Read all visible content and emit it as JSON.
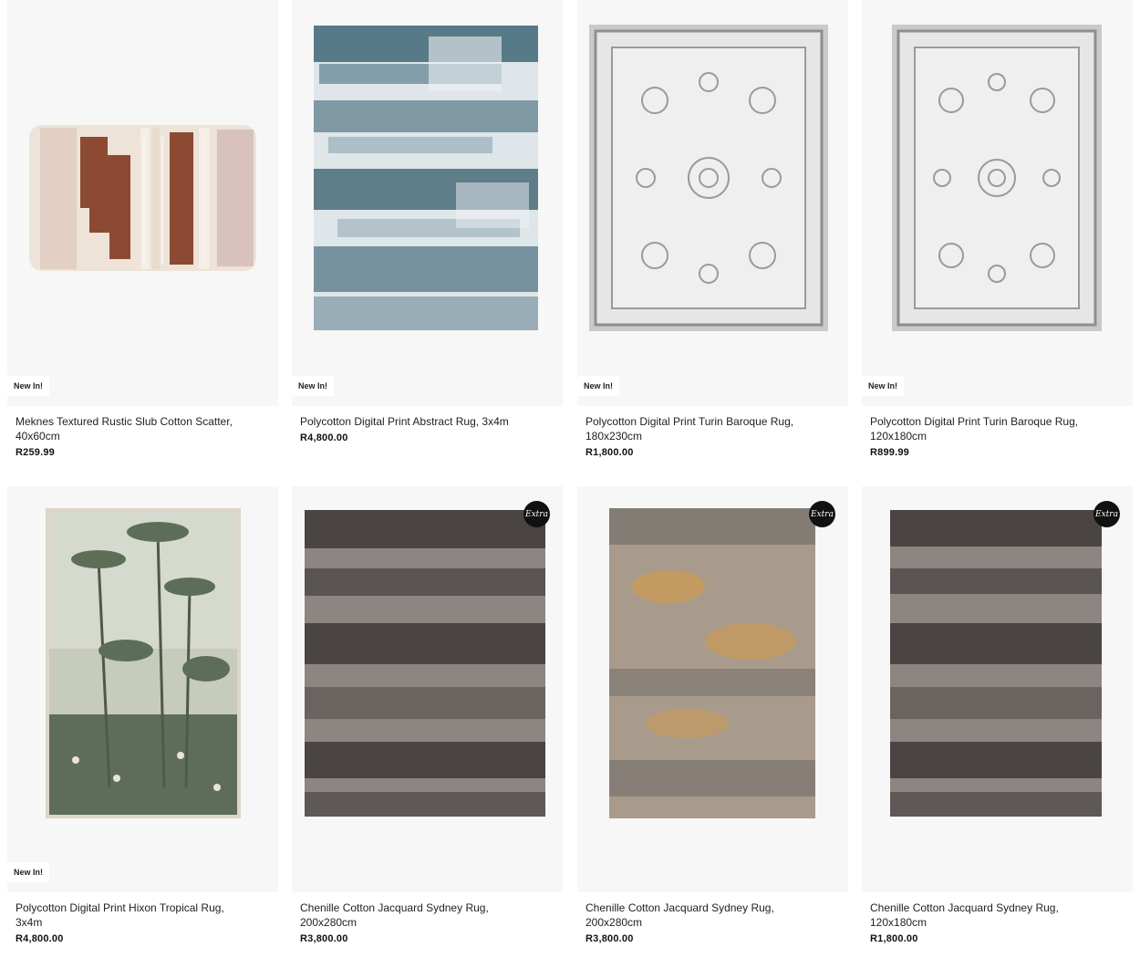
{
  "badges": {
    "new": "New In!",
    "extra": "Extra"
  },
  "products": [
    {
      "title": "Meknes Textured Rustic Slub Cotton Scatter, 40x60cm",
      "price": "R259.99",
      "badge": "New In!"
    },
    {
      "title": "Polycotton Digital Print Abstract Rug, 3x4m",
      "price": "R4,800.00",
      "badge": "New In!"
    },
    {
      "title": "Polycotton Digital Print Turin Baroque Rug, 180x230cm",
      "price": "R1,800.00",
      "badge": "New In!"
    },
    {
      "title": "Polycotton Digital Print Turin Baroque Rug, 120x180cm",
      "price": "R899.99",
      "badge": "New In!"
    },
    {
      "title": "Polycotton Digital Print Hixon Tropical Rug, 3x4m",
      "price": "R4,800.00",
      "badge": "New In!"
    },
    {
      "title": "Chenille Cotton Jacquard Sydney Rug, 200x280cm",
      "price": "R3,800.00",
      "badge": "Extra"
    },
    {
      "title": "Chenille Cotton Jacquard Sydney Rug, 200x280cm",
      "price": "R3,800.00",
      "badge": "Extra"
    },
    {
      "title": "Chenille Cotton Jacquard Sydney Rug, 120x180cm",
      "price": "R1,800.00",
      "badge": "Extra"
    }
  ],
  "colors": {
    "card_bg": "#f7f7f7",
    "cushion_cream": "#ede3d8",
    "cushion_rust": "#8c4a33",
    "abstract_blue": "#3f6677",
    "baroque_grey": "#8e8e8e",
    "tropical_green": "#5d6e58",
    "chenille_dark": "#4a4543",
    "chenille_ochre": "#c99a56"
  }
}
